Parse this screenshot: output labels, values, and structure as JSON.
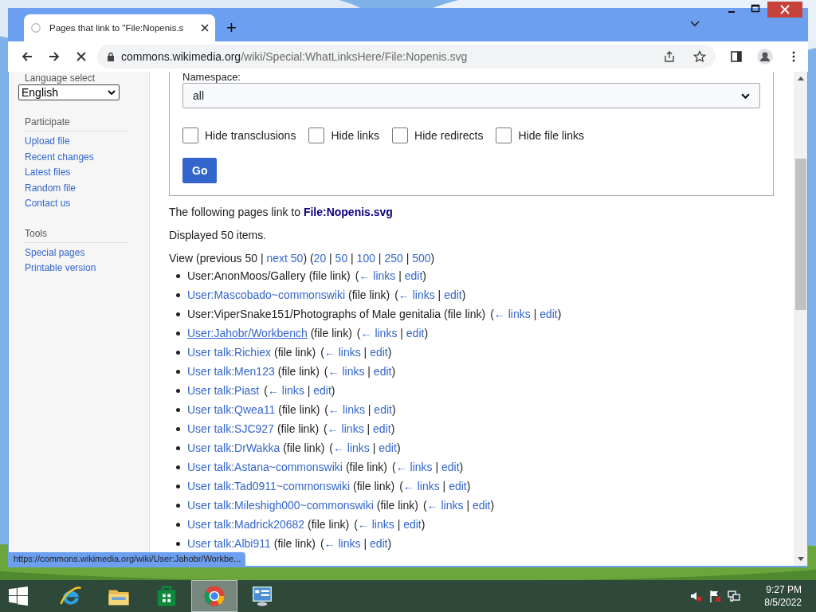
{
  "browser": {
    "tabs": [
      {
        "title": "Pages that link to \"File:Nopenis.s",
        "selected": true
      }
    ],
    "new_tab": "+",
    "address": {
      "host": "commons.wikimedia.org",
      "path": "/wiki/Special:WhatLinksHere/File:Nopenis.svg"
    },
    "status_url": "https://commons.wikimedia.org/wiki/User:Jahobr/Workbe..."
  },
  "sidebar": {
    "language_label": "Language select",
    "language_value": "English",
    "sections": [
      {
        "heading": "Participate",
        "items": [
          "Upload file",
          "Recent changes",
          "Latest files",
          "Random file",
          "Contact us"
        ]
      },
      {
        "heading": "Tools",
        "items": [
          "Special pages",
          "Printable version"
        ]
      }
    ]
  },
  "form": {
    "namespace_label": "Namespace:",
    "namespace_value": "all",
    "checkboxes": [
      {
        "label": "Hide transclusions",
        "checked": false
      },
      {
        "label": "Hide links",
        "checked": false
      },
      {
        "label": "Hide redirects",
        "checked": false
      },
      {
        "label": "Hide file links",
        "checked": false
      }
    ],
    "button": "Go"
  },
  "intro": "The following pages link to **File:Nopenis.svg**",
  "count": "Displayed 50 items.",
  "view_nav": [
    {
      "text": "View (previous 50 | ",
      "link": false
    },
    {
      "text": "next 50",
      "link": true
    },
    {
      "text": ") (",
      "link": false
    },
    {
      "text": "20",
      "link": true
    },
    {
      "text": " | ",
      "link": false
    },
    {
      "text": "50",
      "link": true
    },
    {
      "text": " | ",
      "link": false
    },
    {
      "text": "100",
      "link": true
    },
    {
      "text": " | ",
      "link": false
    },
    {
      "text": "250",
      "link": true
    },
    {
      "text": " | ",
      "link": false
    },
    {
      "text": "500",
      "link": true
    },
    {
      "text": ")",
      "link": false
    }
  ],
  "results": [
    {
      "title": "User:AnonMoos/Gallery",
      "visited": true,
      "hovered": false,
      "note": "(file link)",
      "tools": [
        {
          "text": "(",
          "link": false
        },
        {
          "text": "← links",
          "link": true
        },
        {
          "text": " | ",
          "link": false
        },
        {
          "text": "edit",
          "link": true
        },
        {
          "text": ")",
          "link": false
        }
      ]
    },
    {
      "title": "User:Mascobado~commonswiki",
      "visited": false,
      "hovered": false,
      "note": "(file link)",
      "tools": [
        {
          "text": "(",
          "link": false
        },
        {
          "text": "← links",
          "link": true
        },
        {
          "text": " | ",
          "link": false
        },
        {
          "text": "edit",
          "link": true
        },
        {
          "text": ")",
          "link": false
        }
      ]
    },
    {
      "title": "User:ViperSnake151/Photographs of Male genitalia",
      "visited": true,
      "hovered": false,
      "note": "(file link)",
      "tools": [
        {
          "text": "(",
          "link": false
        },
        {
          "text": "← links",
          "link": true
        },
        {
          "text": " | ",
          "link": false
        },
        {
          "text": "edit",
          "link": true
        },
        {
          "text": ")",
          "link": false
        }
      ]
    },
    {
      "title": "User:Jahobr/Workbench",
      "visited": false,
      "hovered": true,
      "note": "(file link)",
      "tools": [
        {
          "text": "(",
          "link": false
        },
        {
          "text": "← links",
          "link": true
        },
        {
          "text": " | ",
          "link": false
        },
        {
          "text": "edit",
          "link": true
        },
        {
          "text": ")",
          "link": false
        }
      ]
    },
    {
      "title": "User talk:Richiex",
      "visited": false,
      "hovered": false,
      "note": "(file link)",
      "tools": [
        {
          "text": "(",
          "link": false
        },
        {
          "text": "← links",
          "link": true
        },
        {
          "text": " | ",
          "link": false
        },
        {
          "text": "edit",
          "link": true
        },
        {
          "text": ")",
          "link": false
        }
      ]
    },
    {
      "title": "User talk:Men123",
      "visited": false,
      "hovered": false,
      "note": "(file link)",
      "tools": [
        {
          "text": "(",
          "link": false
        },
        {
          "text": "← links",
          "link": true
        },
        {
          "text": " | ",
          "link": false
        },
        {
          "text": "edit",
          "link": true
        },
        {
          "text": ")",
          "link": false
        }
      ]
    },
    {
      "title": "User talk:Piast",
      "visited": false,
      "hovered": false,
      "tools": [
        {
          "text": "(",
          "link": false
        },
        {
          "text": "← links",
          "link": true
        },
        {
          "text": " | ",
          "link": false
        },
        {
          "text": "edit",
          "link": true
        },
        {
          "text": ")",
          "link": false
        }
      ]
    },
    {
      "title": "User talk:Qwea11",
      "visited": false,
      "hovered": false,
      "note": "(file link)",
      "tools": [
        {
          "text": "(",
          "link": false
        },
        {
          "text": "← links",
          "link": true
        },
        {
          "text": " | ",
          "link": false
        },
        {
          "text": "edit",
          "link": true
        },
        {
          "text": ")",
          "link": false
        }
      ]
    },
    {
      "title": "User talk:SJC927",
      "visited": false,
      "hovered": false,
      "note": "(file link)",
      "tools": [
        {
          "text": "(",
          "link": false
        },
        {
          "text": "← links",
          "link": true
        },
        {
          "text": " | ",
          "link": false
        },
        {
          "text": "edit",
          "link": true
        },
        {
          "text": ")",
          "link": false
        }
      ]
    },
    {
      "title": "User talk:DrWakka",
      "visited": false,
      "hovered": false,
      "note": "(file link)",
      "tools": [
        {
          "text": "(",
          "link": false
        },
        {
          "text": "← links",
          "link": true
        },
        {
          "text": " | ",
          "link": false
        },
        {
          "text": "edit",
          "link": true
        },
        {
          "text": ")",
          "link": false
        }
      ]
    },
    {
      "title": "User talk:Astana~commonswiki",
      "visited": false,
      "hovered": false,
      "note": "(file link)",
      "tools": [
        {
          "text": "(",
          "link": false
        },
        {
          "text": "← links",
          "link": true
        },
        {
          "text": " | ",
          "link": false
        },
        {
          "text": "edit",
          "link": true
        },
        {
          "text": ")",
          "link": false
        }
      ]
    },
    {
      "title": "User talk:Tad0911~commonswiki",
      "visited": false,
      "hovered": false,
      "note": "(file link)",
      "tools": [
        {
          "text": "(",
          "link": false
        },
        {
          "text": "← links",
          "link": true
        },
        {
          "text": " | ",
          "link": false
        },
        {
          "text": "edit",
          "link": true
        },
        {
          "text": ")",
          "link": false
        }
      ]
    },
    {
      "title": "User talk:Mileshigh000~commonswiki",
      "visited": false,
      "hovered": false,
      "note": "(file link)",
      "tools": [
        {
          "text": "(",
          "link": false
        },
        {
          "text": "← links",
          "link": true
        },
        {
          "text": " | ",
          "link": false
        },
        {
          "text": "edit",
          "link": true
        },
        {
          "text": ")",
          "link": false
        }
      ]
    },
    {
      "title": "User talk:Madrick20682",
      "visited": false,
      "hovered": false,
      "note": "(file link)",
      "tools": [
        {
          "text": "(",
          "link": false
        },
        {
          "text": "← links",
          "link": true
        },
        {
          "text": " | ",
          "link": false
        },
        {
          "text": "edit",
          "link": true
        },
        {
          "text": ")",
          "link": false
        }
      ]
    },
    {
      "title": "User talk:Albi911",
      "visited": false,
      "hovered": false,
      "note": "(file link)",
      "tools": [
        {
          "text": "(",
          "link": false
        },
        {
          "text": "← links",
          "link": true
        },
        {
          "text": " | ",
          "link": false
        },
        {
          "text": "edit",
          "link": true
        },
        {
          "text": ")",
          "link": false
        }
      ]
    }
  ],
  "taskbar": {
    "apps": [
      {
        "kind": "ie",
        "selected": false
      },
      {
        "kind": "folder",
        "selected": false
      },
      {
        "kind": "store",
        "selected": false
      },
      {
        "kind": "chrome",
        "selected": true
      },
      {
        "kind": "panel",
        "selected": false
      }
    ],
    "time": "9:27 PM",
    "date": "8/5/2022"
  }
}
